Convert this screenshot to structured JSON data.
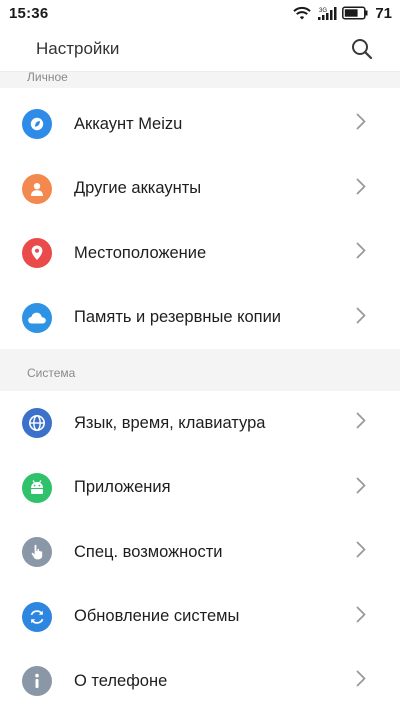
{
  "status_bar": {
    "time": "15:36",
    "battery": "71",
    "network": "3G"
  },
  "header": {
    "title": "Настройки"
  },
  "sections": {
    "personal": {
      "title": "Личное",
      "items": [
        {
          "label": "Аккаунт Meizu",
          "icon": "meizu-account-icon",
          "color": "#2f8be8"
        },
        {
          "label": "Другие аккаунты",
          "icon": "person-icon",
          "color": "#f3894f"
        },
        {
          "label": "Местоположение",
          "icon": "location-pin-icon",
          "color": "#ea4a4a"
        },
        {
          "label": "Память и резервные копии",
          "icon": "cloud-icon",
          "color": "#2e93e4"
        }
      ]
    },
    "system": {
      "title": "Система",
      "items": [
        {
          "label": "Язык, время, клавиатура",
          "icon": "globe-icon",
          "color": "#3b71c9"
        },
        {
          "label": "Приложения",
          "icon": "android-icon",
          "color": "#2fc26b"
        },
        {
          "label": "Спец. возможности",
          "icon": "hand-pointer-icon",
          "color": "#8a97a6"
        },
        {
          "label": "Обновление системы",
          "icon": "refresh-icon",
          "color": "#2d86e0"
        },
        {
          "label": "О телефоне",
          "icon": "info-icon",
          "color": "#8a97a6"
        }
      ]
    }
  }
}
